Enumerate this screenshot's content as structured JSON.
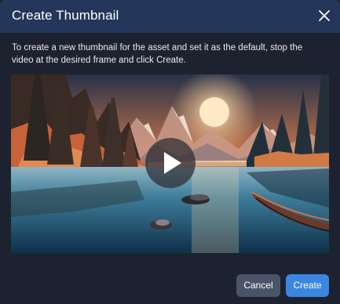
{
  "dialog": {
    "title": "Create Thumbnail",
    "description": "To create a new thumbnail for the asset and set it as the default, stop the video at the desired frame and click Create.",
    "close_icon": "close-icon",
    "play_icon": "play-icon"
  },
  "buttons": {
    "cancel_label": "Cancel",
    "create_label": "Create"
  },
  "colors": {
    "header": "#24375a",
    "background": "#1d2230",
    "primary": "#3a86e0",
    "secondary": "#4a5468"
  }
}
